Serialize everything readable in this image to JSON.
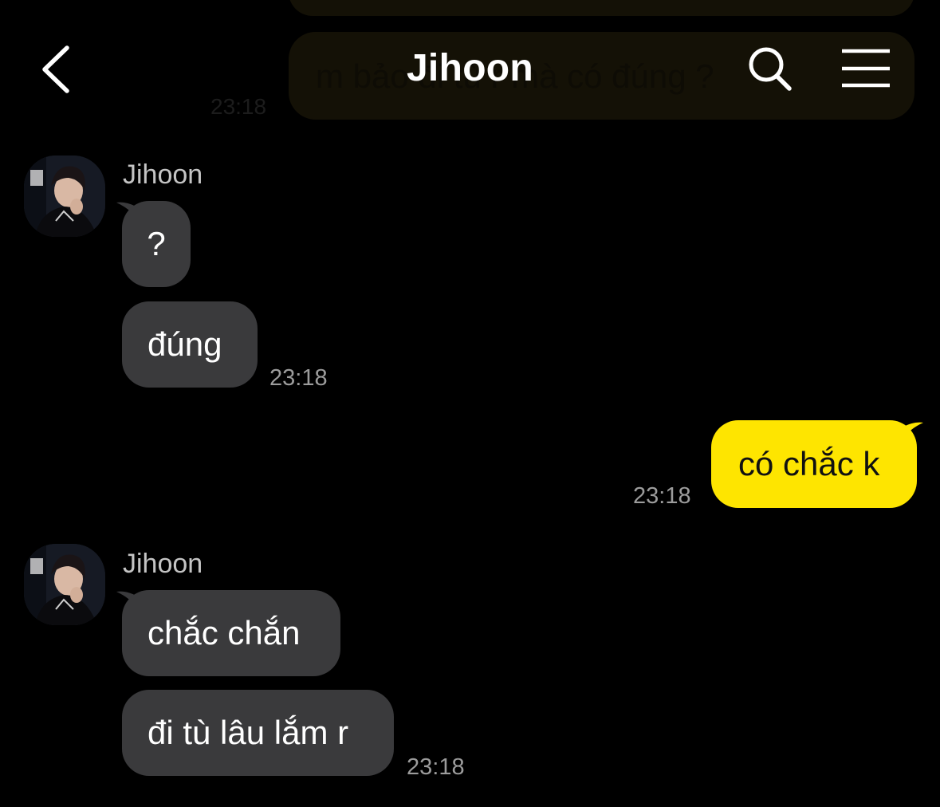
{
  "background": {
    "partial_message": "m bảo đi tù r mà có đúng ?",
    "partial_time": "23:18"
  },
  "header": {
    "title": "Jihoon",
    "back_icon": "chevron-left-icon",
    "search_icon": "search-icon",
    "menu_icon": "hamburger-menu-icon"
  },
  "colors": {
    "background": "#000000",
    "incoming_bubble": "#3a3a3c",
    "outgoing_bubble": "#fee500",
    "timestamp": "#9c9c9c"
  },
  "messages": {
    "group1": {
      "sender": "Jihoon",
      "bubbles": [
        "?",
        "đúng"
      ],
      "time": "23:18"
    },
    "outgoing1": {
      "text": "có chắc k",
      "time": "23:18"
    },
    "group2": {
      "sender": "Jihoon",
      "bubbles": [
        "chắc chắn",
        "đi tù lâu lắm r"
      ],
      "time": "23:18"
    }
  }
}
